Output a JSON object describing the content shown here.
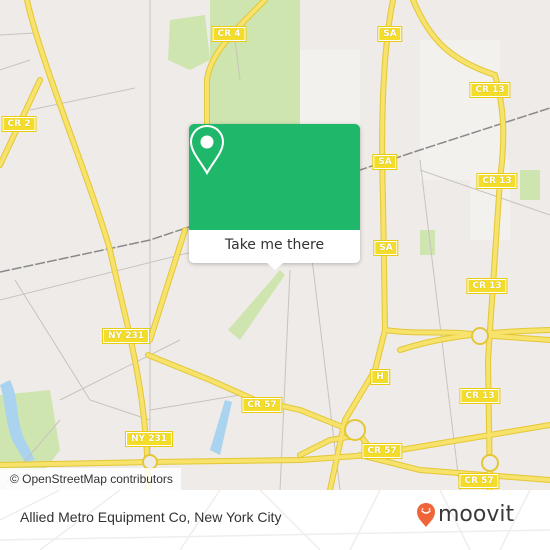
{
  "map": {
    "colors": {
      "background": "#efebe8",
      "park": "#cfe5b0",
      "road": "#f7e26b",
      "road_casing": "#e8cc3b",
      "water": "#a9d3ee",
      "minor_road": "#ffffff",
      "rail": "#8a8a8a"
    },
    "shields": [
      {
        "id": "cr4",
        "label": "CR 4"
      },
      {
        "id": "cr2",
        "label": "CR 2"
      },
      {
        "id": "sa-top",
        "label": "SA"
      },
      {
        "id": "cr13-top",
        "label": "CR 13"
      },
      {
        "id": "sa-mid",
        "label": "SA"
      },
      {
        "id": "cr13-mid",
        "label": "CR 13"
      },
      {
        "id": "sa-low",
        "label": "SA"
      },
      {
        "id": "cr13-low",
        "label": "CR 13"
      },
      {
        "id": "ny231-top",
        "label": "NY 231"
      },
      {
        "id": "h",
        "label": "H"
      },
      {
        "id": "cr13-bottom",
        "label": "CR 13"
      },
      {
        "id": "cr57-left",
        "label": "CR 57"
      },
      {
        "id": "ny231-bottom",
        "label": "NY 231"
      },
      {
        "id": "cr57-mid",
        "label": "CR 57"
      },
      {
        "id": "cr57-right",
        "label": "CR 57"
      }
    ],
    "attribution": "© OpenStreetMap contributors"
  },
  "popup": {
    "icon": "map-pin-icon",
    "accent": "#1fb86b",
    "action_label": "Take me there"
  },
  "footer": {
    "place_name": "Allied Metro Equipment Co, New York City",
    "brand": "moovit",
    "brand_icon": "moovit-smiley-pin-icon",
    "brand_color": "#f0643a"
  }
}
